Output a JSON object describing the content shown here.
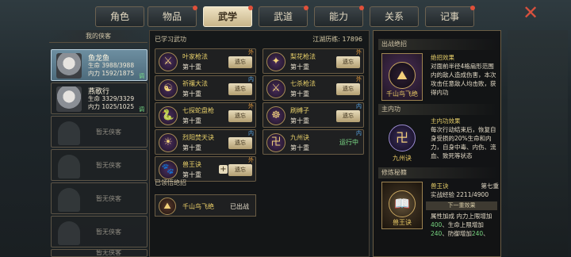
{
  "tabs": [
    {
      "label": "角色",
      "active": false,
      "notify": false
    },
    {
      "label": "物品",
      "active": false,
      "notify": true
    },
    {
      "label": "武学",
      "active": true,
      "notify": true
    },
    {
      "label": "武道",
      "active": false,
      "notify": true
    },
    {
      "label": "能力",
      "active": false,
      "notify": true
    },
    {
      "label": "关系",
      "active": false,
      "notify": false
    },
    {
      "label": "记事",
      "active": false,
      "notify": true
    }
  ],
  "close_icon": "close-icon",
  "left": {
    "header": "我的侠客",
    "knights": [
      {
        "name": "鱼龙鱼",
        "hp": "生命 3988/3988",
        "mp": "内力 1592/1875",
        "tag": "调"
      },
      {
        "name": "燕歌行",
        "hp": "生命 3329/3329",
        "mp": "内力 1025/1025",
        "tag": "调"
      }
    ],
    "empty_slots": [
      "暂无侠客",
      "暂无侠客",
      "暂无侠客",
      "暂无侠客",
      "暂无侠客"
    ]
  },
  "middle": {
    "learned_title": "已学习武功",
    "exp_label": "江湖历练:",
    "exp_value": "17896",
    "skills": [
      {
        "name": "叶家枪法",
        "level": "第十重",
        "btn": "遗忘",
        "type": "外",
        "typeclass": "out"
      },
      {
        "name": "梨花枪法",
        "level": "第十重",
        "btn": "遗忘",
        "type": "外",
        "typeclass": "out"
      },
      {
        "name": "祈禳大法",
        "level": "第十重",
        "btn": "遗忘",
        "type": "内",
        "typeclass": "in"
      },
      {
        "name": "七杀枪法",
        "level": "第十重",
        "btn": "遗忘",
        "type": "外",
        "typeclass": "out"
      },
      {
        "name": "七探蛇盘枪",
        "level": "第十重",
        "btn": "遗忘",
        "type": "外",
        "typeclass": "out"
      },
      {
        "name": "刷缚子",
        "level": "第十重",
        "btn": "遗忘",
        "type": "内",
        "typeclass": "in"
      },
      {
        "name": "烈阳焚天诀",
        "level": "第十重",
        "btn": "遗忘",
        "type": "内",
        "typeclass": "in"
      },
      {
        "name": "九州诀",
        "level": "第十重",
        "btn": "运行中",
        "type": "内",
        "typeclass": "in"
      },
      {
        "name": "兽王诀",
        "level": "第十重",
        "btn": "遗忘",
        "type": "外",
        "typeclass": "out"
      }
    ],
    "ult_title": "已领悟绝招",
    "ult": {
      "name": "千山鸟飞绝",
      "status": "已出战"
    }
  },
  "right": {
    "s1_title": "出战绝招",
    "s1_badge": "千山鸟飞绝",
    "s1_head": "绝招效果",
    "s1_text": "对面前半径4格扇形范围内的敌人造成伤害，本次攻击任意敌人均击败，获得内功",
    "s2_title": "主内功",
    "s2_badge": "九州诀",
    "s2_head": "主内功效果",
    "s2_text": "每次行动结束后，恢复自身受损的20%生命和内力，自身中毒、内伤、流血、致死等状态",
    "s3_title": "修炼秘籍",
    "s3_badge": "兽王诀",
    "s3_name": "兽王诀",
    "s3_level": "第七重",
    "s3_exp": "实战经验 2211/4900",
    "s3_next": "下一重效果",
    "s3_text_a": "属性加成",
    "s3_text_b": "内力上限增加",
    "s3_v1": "400",
    "s3_text_c": "、生命上限增加",
    "s3_v2": "240",
    "s3_text_d": "、防御增加",
    "s3_v3": "240",
    "s3_text_e": "、"
  }
}
